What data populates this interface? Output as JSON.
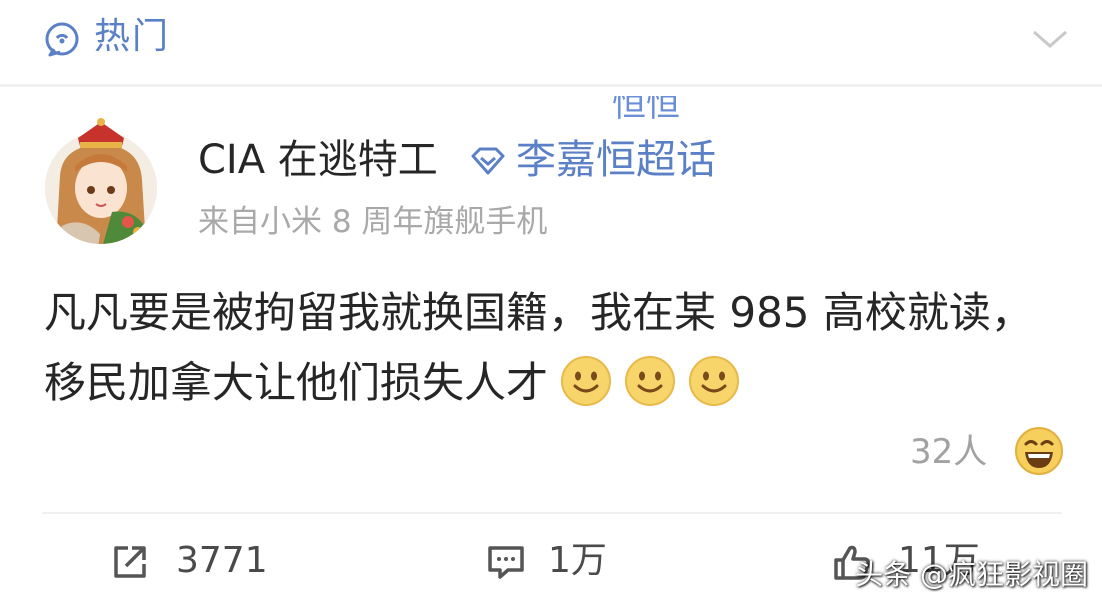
{
  "section": {
    "label": "热门",
    "icon": "hot-topic-icon"
  },
  "post": {
    "stray_text": "恒恒",
    "author": "CIA 在逃特工",
    "super_topic": "李嘉恒超话",
    "source": "来自小米 8 周年旗舰手机",
    "content": "凡凡要是被拘留我就换国籍，我在某 985 高校就读，移民加拿大让他们损失人才",
    "emoji_count": 3,
    "reactions": {
      "count": "32人"
    }
  },
  "actions": {
    "repost": "3771",
    "comment": "1万",
    "like": "11万"
  },
  "watermark": "头条 @疯狂影视圈",
  "colors": {
    "link_blue": "#5b80c6",
    "text": "#262626",
    "muted": "#a9a9a9"
  }
}
